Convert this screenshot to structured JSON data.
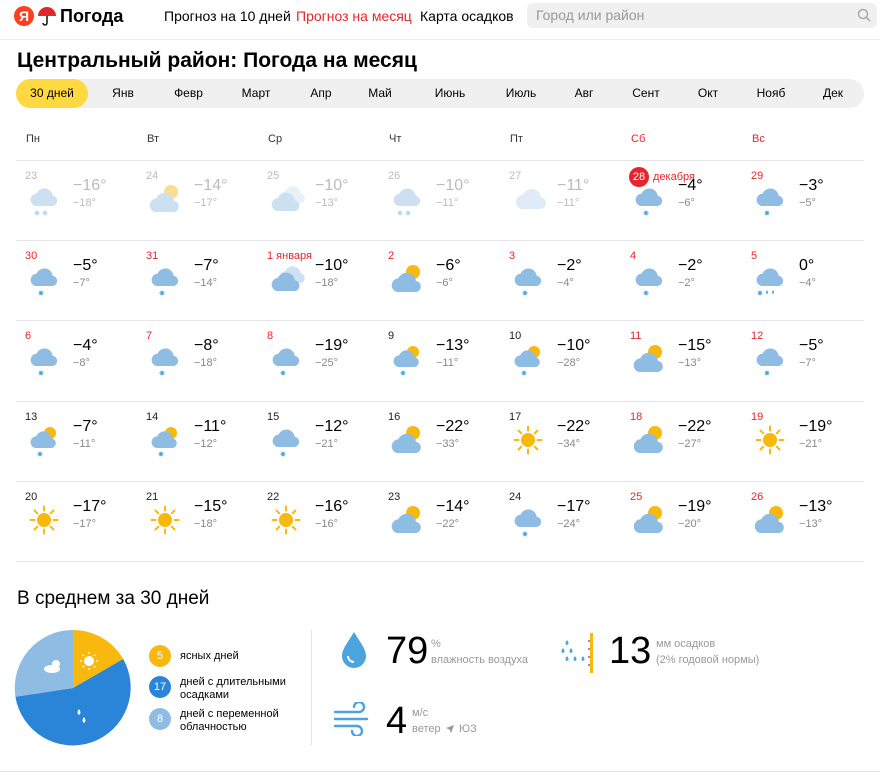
{
  "header": {
    "logo_letter": "Я",
    "logo_text": "Погода",
    "nav": [
      "Прогноз на 10 дней",
      "Прогноз на месяц",
      "Карта осадков"
    ],
    "search_placeholder": "Город или район"
  },
  "title": "Центральный район: Погода на месяц",
  "months": [
    "30 дней",
    "Янв",
    "Февр",
    "Март",
    "Апр",
    "Май",
    "Июнь",
    "Июль",
    "Авг",
    "Сент",
    "Окт",
    "Нояб",
    "Дек"
  ],
  "weekdays": [
    "Пн",
    "Вт",
    "Ср",
    "Чт",
    "Пт",
    "Сб",
    "Вс"
  ],
  "weeks": [
    [
      {
        "day": "23",
        "hi": "−16°",
        "lo": "−18°",
        "icon": "cloud-snow-icon",
        "past": true
      },
      {
        "day": "24",
        "hi": "−14°",
        "lo": "−17°",
        "icon": "partly-cloudy-icon",
        "past": true
      },
      {
        "day": "25",
        "hi": "−10°",
        "lo": "−13°",
        "icon": "cloudy-icon",
        "past": true
      },
      {
        "day": "26",
        "hi": "−10°",
        "lo": "−11°",
        "icon": "cloud-snow-icon",
        "past": true
      },
      {
        "day": "27",
        "hi": "−11°",
        "lo": "−11°",
        "icon": "cloud-icon",
        "past": true
      },
      {
        "day": "28",
        "day_label": "декабря",
        "hi": "−4°",
        "lo": "−6°",
        "icon": "cloud-snowflake-icon",
        "today": true
      },
      {
        "day": "29",
        "hi": "−3°",
        "lo": "−5°",
        "icon": "cloud-snowflake-icon"
      }
    ],
    [
      {
        "day": "30",
        "hi": "−5°",
        "lo": "−7°",
        "icon": "cloud-snowflake-icon",
        "red": true
      },
      {
        "day": "31",
        "hi": "−7°",
        "lo": "−14°",
        "icon": "cloud-snowflake-icon",
        "red": true
      },
      {
        "day": "1 января",
        "hi": "−10°",
        "lo": "−18°",
        "icon": "cloudy-icon",
        "red": true
      },
      {
        "day": "2",
        "hi": "−6°",
        "lo": "−6°",
        "icon": "partly-cloudy-icon",
        "red": true
      },
      {
        "day": "3",
        "hi": "−2°",
        "lo": "−4°",
        "icon": "cloud-snowflake-icon",
        "red": true
      },
      {
        "day": "4",
        "hi": "−2°",
        "lo": "−2°",
        "icon": "cloud-snowflake-icon"
      },
      {
        "day": "5",
        "hi": "0°",
        "lo": "−4°",
        "icon": "cloud-sleet-icon"
      }
    ],
    [
      {
        "day": "6",
        "hi": "−4°",
        "lo": "−8°",
        "icon": "cloud-snowflake-icon",
        "red": true
      },
      {
        "day": "7",
        "hi": "−8°",
        "lo": "−18°",
        "icon": "cloud-snowflake-icon",
        "red": true
      },
      {
        "day": "8",
        "hi": "−19°",
        "lo": "−25°",
        "icon": "cloud-snowflake-icon",
        "red": true
      },
      {
        "day": "9",
        "hi": "−13°",
        "lo": "−11°",
        "icon": "partly-cloudy-snow-icon"
      },
      {
        "day": "10",
        "hi": "−10°",
        "lo": "−28°",
        "icon": "partly-cloudy-snow-icon"
      },
      {
        "day": "11",
        "hi": "−15°",
        "lo": "−13°",
        "icon": "partly-cloudy-icon"
      },
      {
        "day": "12",
        "hi": "−5°",
        "lo": "−7°",
        "icon": "cloud-snowflake-icon"
      }
    ],
    [
      {
        "day": "13",
        "hi": "−7°",
        "lo": "−11°",
        "icon": "partly-cloudy-snow-icon"
      },
      {
        "day": "14",
        "hi": "−11°",
        "lo": "−12°",
        "icon": "partly-cloudy-snow-icon"
      },
      {
        "day": "15",
        "hi": "−12°",
        "lo": "−21°",
        "icon": "cloud-snowflake-icon"
      },
      {
        "day": "16",
        "hi": "−22°",
        "lo": "−33°",
        "icon": "partly-cloudy-icon"
      },
      {
        "day": "17",
        "hi": "−22°",
        "lo": "−34°",
        "icon": "sun-icon"
      },
      {
        "day": "18",
        "hi": "−22°",
        "lo": "−27°",
        "icon": "partly-cloudy-icon"
      },
      {
        "day": "19",
        "hi": "−19°",
        "lo": "−21°",
        "icon": "sun-icon"
      }
    ],
    [
      {
        "day": "20",
        "hi": "−17°",
        "lo": "−17°",
        "icon": "sun-icon"
      },
      {
        "day": "21",
        "hi": "−15°",
        "lo": "−18°",
        "icon": "sun-icon"
      },
      {
        "day": "22",
        "hi": "−16°",
        "lo": "−16°",
        "icon": "sun-icon"
      },
      {
        "day": "23",
        "hi": "−14°",
        "lo": "−22°",
        "icon": "partly-cloudy-icon"
      },
      {
        "day": "24",
        "hi": "−17°",
        "lo": "−24°",
        "icon": "cloud-snowflake-icon"
      },
      {
        "day": "25",
        "hi": "−19°",
        "lo": "−20°",
        "icon": "partly-cloudy-icon"
      },
      {
        "day": "26",
        "hi": "−13°",
        "lo": "−13°",
        "icon": "partly-cloudy-icon"
      }
    ]
  ],
  "summary": {
    "title": "В среднем за 30 дней",
    "legend": [
      {
        "count": "5",
        "text": "ясных дней",
        "color": "#f8b80d"
      },
      {
        "count": "17",
        "text": "дней с длительными осадками",
        "color": "#2a85d9"
      },
      {
        "count": "8",
        "text": "дней с переменной облачностью",
        "color": "#8fbce2"
      }
    ],
    "humidity": {
      "value": "79",
      "unit": "%",
      "label": "влажность воздуха"
    },
    "precip": {
      "value": "13",
      "unit": "мм осадков",
      "label": "(2% годовой нормы)"
    },
    "wind": {
      "value": "4",
      "unit": "м/с",
      "label": "ветер",
      "dir": "ЮЗ"
    }
  },
  "colors": {
    "accent": "#e3262d",
    "active_month": "#ffd93f",
    "sun": "#f8b80d",
    "cloud": "#8fbce2",
    "snow": "#4ba3df"
  }
}
